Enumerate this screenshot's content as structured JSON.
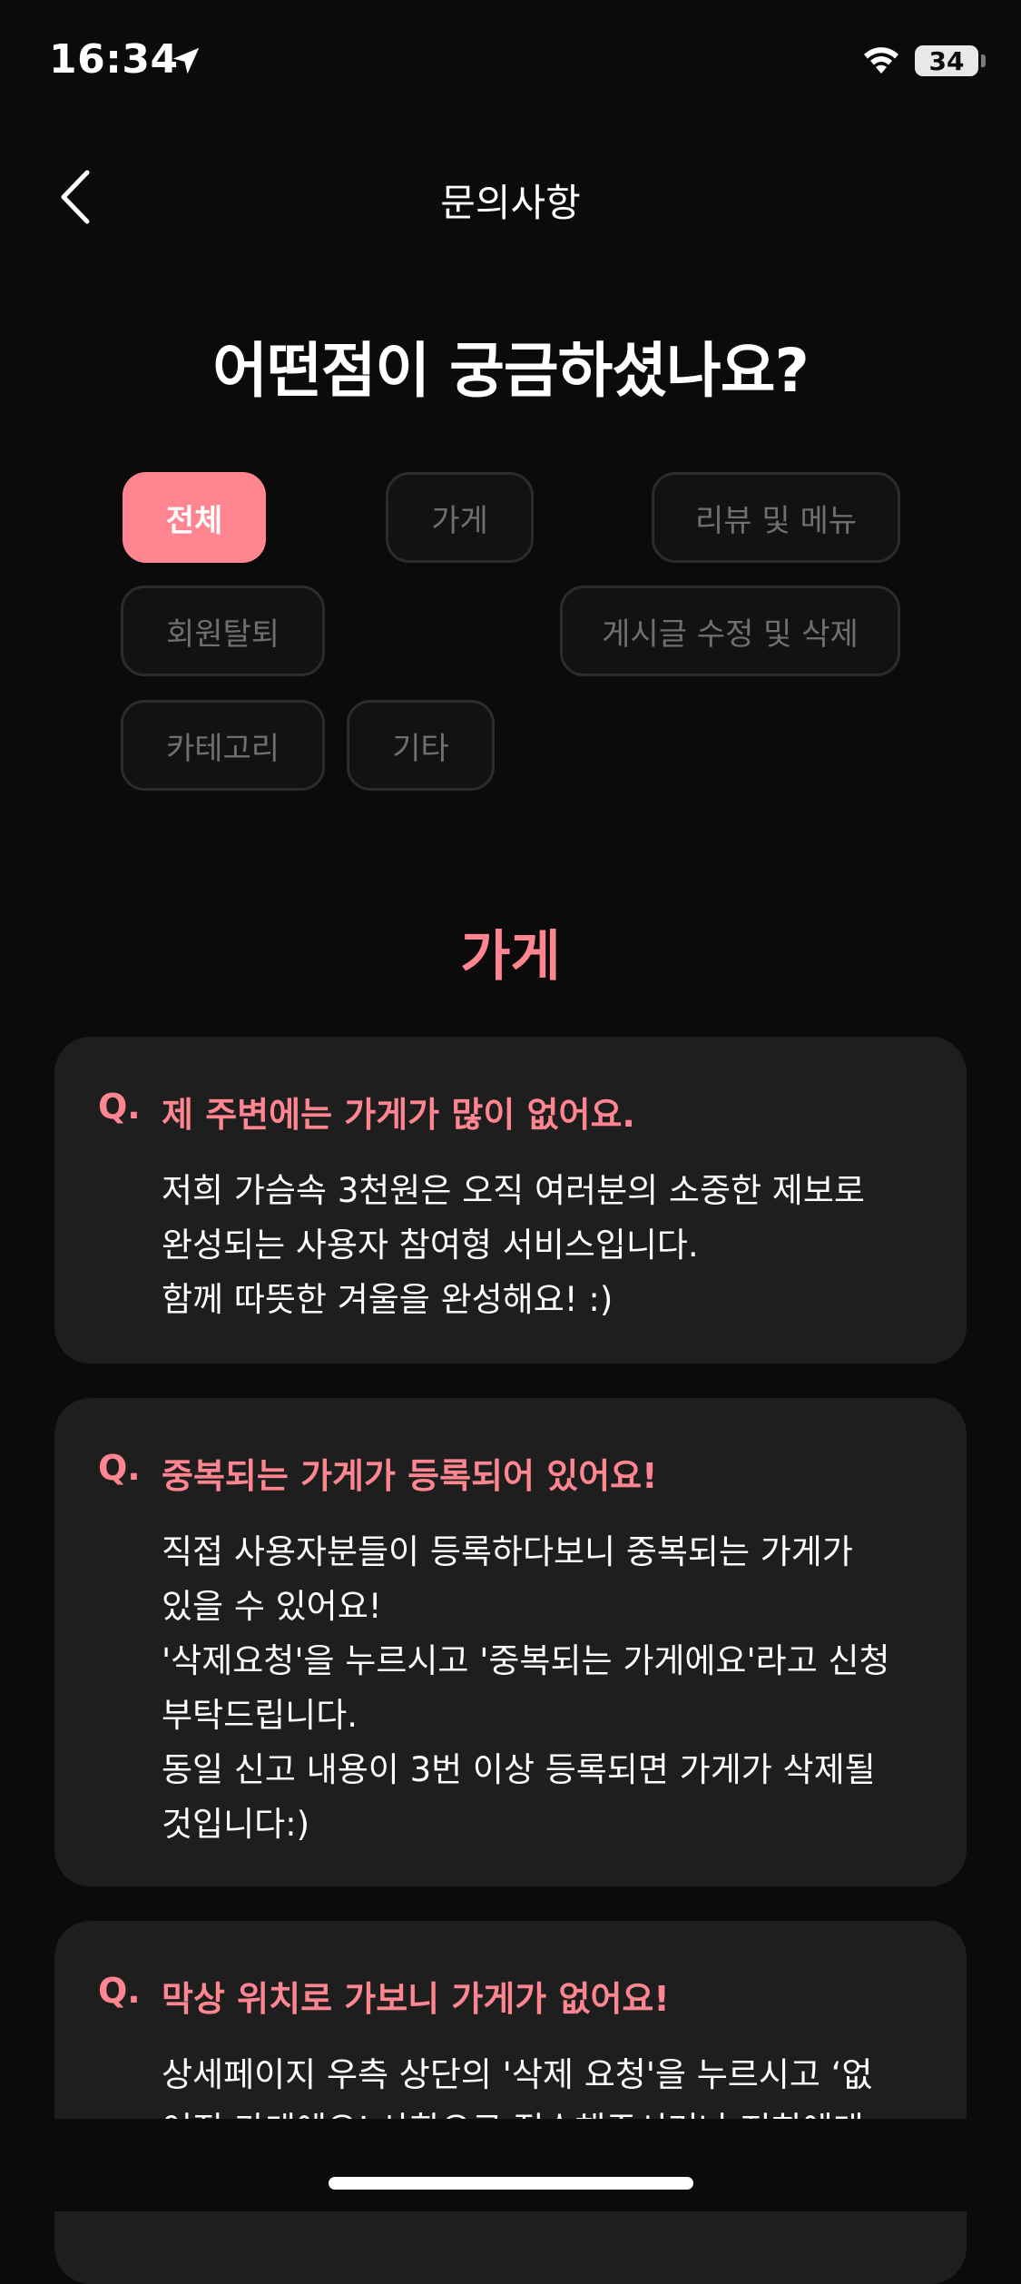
{
  "status_bar": {
    "time": "16:34",
    "battery": "34"
  },
  "header": {
    "title": "문의사항"
  },
  "headline": "어떤점이 궁금하셨나요?",
  "filters": [
    {
      "label": "전체",
      "active": true
    },
    {
      "label": "가게"
    },
    {
      "label": "리뷰 및 메뉴"
    },
    {
      "label": "회원탈퇴"
    },
    {
      "label": "게시글 수정 및 삭제"
    },
    {
      "label": "카테고리"
    },
    {
      "label": "기타"
    }
  ],
  "section_title": "가게",
  "accent_color": "#ff8591",
  "faq": [
    {
      "q_label": "Q.",
      "question": "제 주변에는 가게가 많이 없어요.",
      "answer_lines": [
        "저희 가슴속 3천원은 오직 여러분의 소중한 제보로",
        "완성되는 사용자 참여형 서비스입니다.",
        "함께 따뜻한 겨울을 완성해요! :)"
      ]
    },
    {
      "q_label": "Q.",
      "question": "중복되는 가게가 등록되어 있어요!",
      "answer_lines": [
        "직접 사용자분들이 등록하다보니 중복되는 가게가",
        "있을 수 있어요!",
        "'삭제요청'을 누르시고 '중복되는 가게에요'라고 신청",
        "부탁드립니다.",
        "동일 신고 내용이 3번 이상 등록되면 가게가 삭제될",
        "것입니다:)"
      ]
    },
    {
      "q_label": "Q.",
      "question": "막상 위치로 가보니 가게가 없어요!",
      "answer_lines": [
        "상세페이지 우측 상단의 '삭제 요청'을 누르시고 ‘없",
        "어진 가게에요’ 사항으로 접수해주시거나 저희에게"
      ]
    }
  ]
}
